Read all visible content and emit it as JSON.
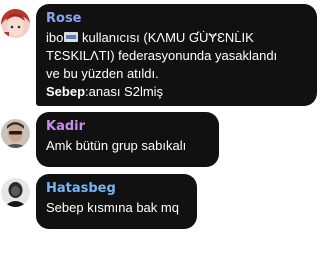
{
  "messages": [
    {
      "sender": "Rose",
      "sender_color": "#8ea3f0",
      "avatar": "anime-girl-avatar",
      "line1_prefix": "ibo",
      "line1_suffix": " kullanıcısı (KΛMU ƓU̇ɎƐNL̇IK",
      "line2": "TƐSKILΛTI) federasyonunda yasaklandı",
      "line3": "ve bu yüzden atıldı.",
      "reason_label": "Sebep",
      "reason_value": ":anası S2lmiş"
    },
    {
      "sender": "Kadir",
      "sender_color": "#c58ee8",
      "avatar": "person-avatar",
      "text": "Amk bütün grup sabıkalı"
    },
    {
      "sender": "Hatasbeg",
      "sender_color": "#74b6f2",
      "avatar": "dark-person-avatar",
      "text": "Sebep kısmına bak mq"
    }
  ]
}
